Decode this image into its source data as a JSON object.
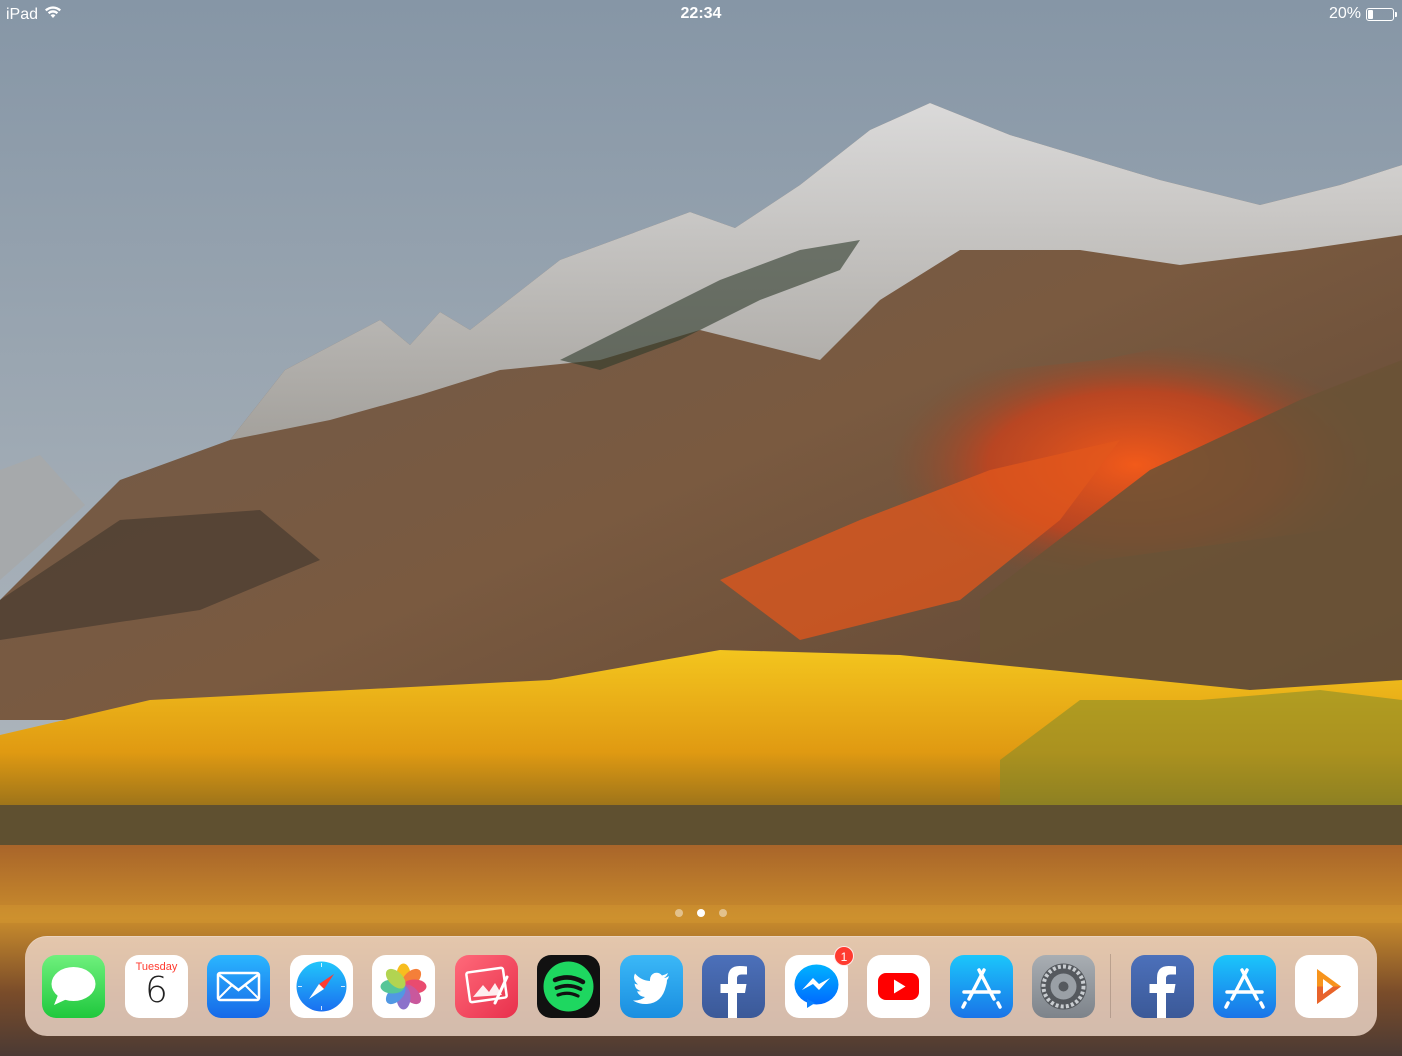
{
  "status_bar": {
    "device": "iPad",
    "time": "22:34",
    "battery_text": "20%",
    "battery_level": 0.2
  },
  "home_screen": {
    "page_count": 3,
    "current_page_index": 1
  },
  "dock": {
    "apps": [
      {
        "name": "Messages",
        "icon": "messages-icon"
      },
      {
        "name": "Calendar",
        "icon": "calendar-icon",
        "day_label": "Tuesday",
        "date_number": "6"
      },
      {
        "name": "Mail",
        "icon": "mail-icon"
      },
      {
        "name": "Safari",
        "icon": "safari-icon"
      },
      {
        "name": "Photos",
        "icon": "photos-icon"
      },
      {
        "name": "Pixelmator",
        "icon": "pixelmator-icon"
      },
      {
        "name": "Spotify",
        "icon": "spotify-icon"
      },
      {
        "name": "Twitter",
        "icon": "twitter-icon"
      },
      {
        "name": "Facebook",
        "icon": "facebook-icon"
      },
      {
        "name": "Messenger",
        "icon": "messenger-icon",
        "badge": "1"
      },
      {
        "name": "YouTube",
        "icon": "youtube-icon"
      },
      {
        "name": "App Store",
        "icon": "app-store-icon"
      },
      {
        "name": "Settings",
        "icon": "settings-icon"
      }
    ],
    "recent_apps": [
      {
        "name": "Facebook",
        "icon": "facebook-icon"
      },
      {
        "name": "App Store",
        "icon": "app-store-icon"
      },
      {
        "name": "Infuse",
        "icon": "infuse-icon"
      }
    ]
  },
  "colors": {
    "messages": "#3ddc57",
    "mail": "#1e90f5",
    "twitter": "#1da1f2",
    "facebook": "#3b5998",
    "youtube": "#ff0000",
    "spotify": "#1ed760",
    "app_store": "#1a8cf0",
    "badge": "#ff3b30"
  }
}
